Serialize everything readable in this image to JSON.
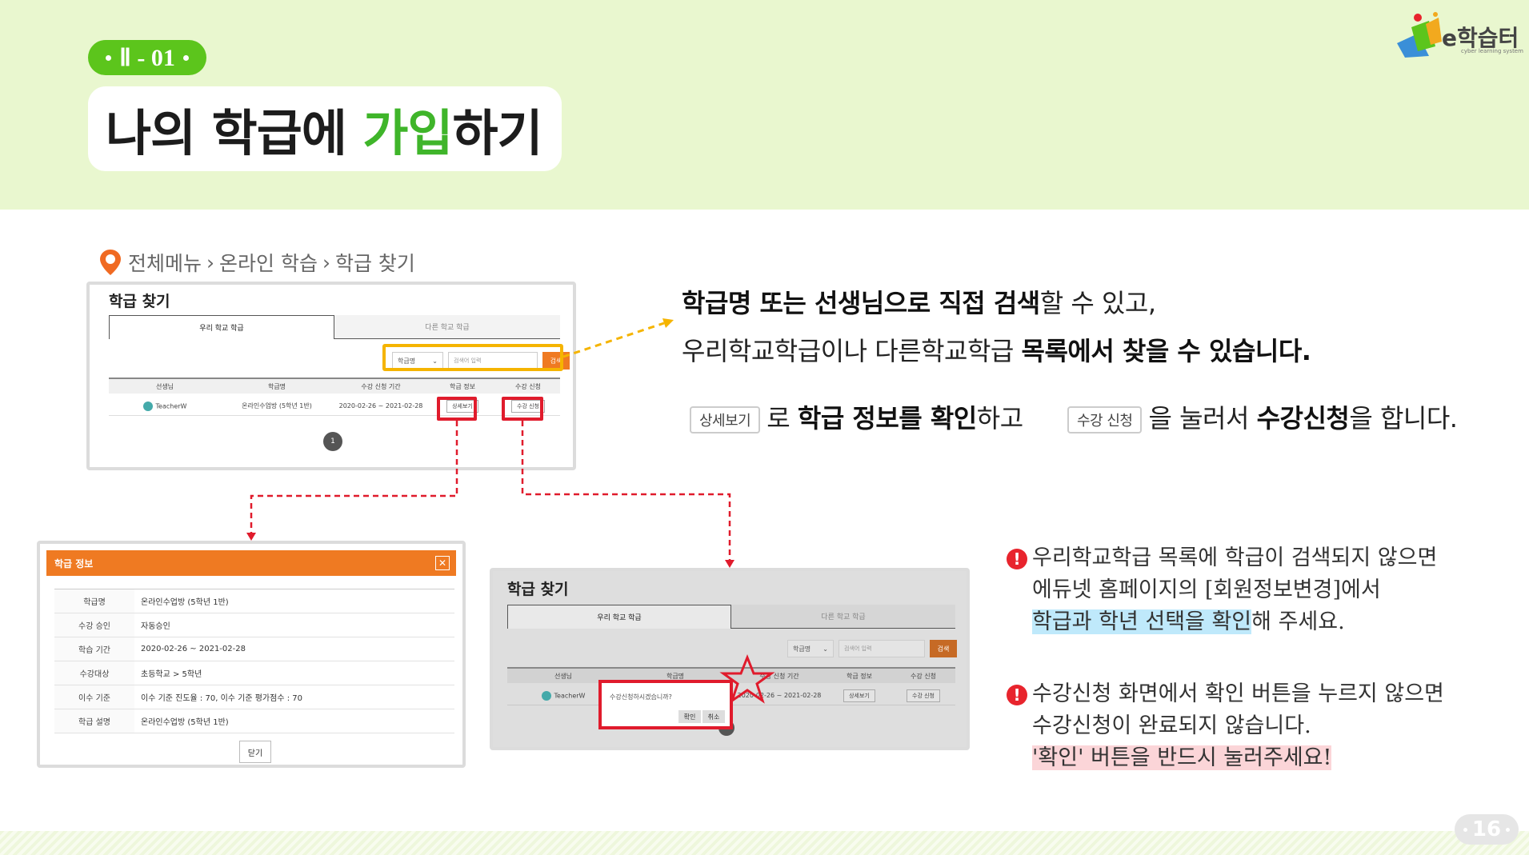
{
  "header": {
    "section": "Ⅱ - 01",
    "title_part1": "나의 학급에 ",
    "title_accent": "가입",
    "title_part2": "하기"
  },
  "logo": {
    "text": "e학습터",
    "sub": "cyber learning system"
  },
  "breadcrumb": [
    "전체메뉴",
    "온라인 학습",
    "학급 찾기"
  ],
  "breadcrumb_sep": "›",
  "search_panel": {
    "title": "학급 찾기",
    "tabs": [
      "우리 학교 학급",
      "다른 학교 학급"
    ],
    "select_value": "학급명",
    "input_placeholder": "검색어 입력",
    "search_button": "검색",
    "columns": [
      "선생님",
      "학급명",
      "수강 신청 기간",
      "학급 정보",
      "수강 신청"
    ],
    "row": {
      "teacher": "TeacherW",
      "class_name": "온라인수업방 (5학년 1반)",
      "period": "2020-02-26 ~ 2021-02-28",
      "detail_button": "상세보기",
      "apply_button": "수강 신청"
    },
    "page": "1"
  },
  "info_panel": {
    "title": "학급 정보",
    "rows": [
      {
        "k": "학급명",
        "v": "온라인수업방 (5학년 1반)"
      },
      {
        "k": "수강 승인",
        "v": "자동승인"
      },
      {
        "k": "학습 기간",
        "v": "2020-02-26 ~ 2021-02-28"
      },
      {
        "k": "수강대상",
        "v": "초등학교 > 5학년"
      },
      {
        "k": "이수 기준",
        "v": "이수 기준 진도율 : 70, 이수 기준 평가점수 : 70"
      },
      {
        "k": "학급 설명",
        "v": "온라인수업방 (5학년 1반)"
      }
    ],
    "close_button": "닫기"
  },
  "confirm_panel": {
    "title": "학급 찾기",
    "tabs": [
      "우리 학교 학급",
      "다른 학교 학급"
    ],
    "select_value": "학급명",
    "input_placeholder": "검색어 입력",
    "search_button": "검색",
    "columns": [
      "선생님",
      "학급명",
      "수강 신청 기간",
      "학급 정보",
      "수강 신청"
    ],
    "row": {
      "teacher": "TeacherW",
      "period": "2020-02-26 ~ 2021-02-28",
      "detail_button": "상세보기",
      "apply_button": "수강 신청"
    },
    "dialog_text": "수강신청하시겠습니까?",
    "ok_button": "확인",
    "cancel_button": "취소"
  },
  "desc": {
    "line1_bold": "학급명 또는 선생님으로 직접 검색",
    "line1_rest": "할 수 있고,",
    "line2_pre": "우리학교학급이나 다른학교학급 ",
    "line2_bold": "목록에서 찾을 수 있습니다.",
    "chip1": "상세보기",
    "line3_a": "로 ",
    "line3_bold1": "학급 정보를 확인",
    "line3_b": "하고",
    "chip2": "수강 신청",
    "line3_c": "을 눌러서 ",
    "line3_bold2": "수강신청",
    "line3_d": "을 합니다."
  },
  "notes": {
    "note1_line1": "우리학교학급 목록에 학급이 검색되지 않으면",
    "note1_line2": "에듀넷 홈페이지의 [회원정보변경]에서",
    "note1_line3_hl": "학급과 학년 선택을 확인",
    "note1_line3_rest": "해 주세요.",
    "note2_line1": "수강신청 화면에서 확인 버튼을 누르지 않으면",
    "note2_line2": "수강신청이 완료되지 않습니다.",
    "note2_line3_hl": "'확인' 버튼을 반드시 눌러주세요!"
  },
  "page_number": "16",
  "colors": {
    "accent_green": "#3fb52a",
    "badge_green": "#5cc51c",
    "orange": "#ef7a22",
    "red": "#e01b2c",
    "yellow": "#f5b400"
  }
}
